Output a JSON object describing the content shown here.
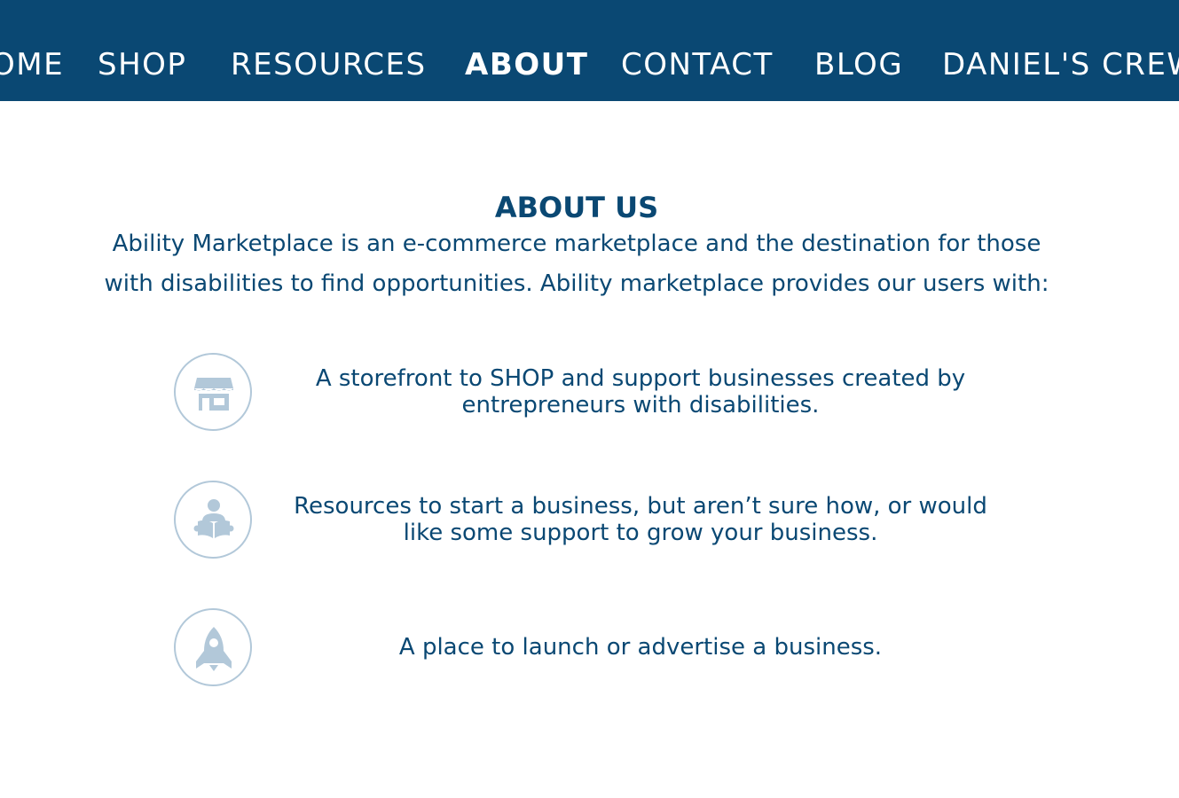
{
  "nav": {
    "items": [
      {
        "label": "OME",
        "active": false
      },
      {
        "label": "SHOP",
        "active": false
      },
      {
        "label": "RESOURCES",
        "active": false
      },
      {
        "label": "ABOUT",
        "active": true
      },
      {
        "label": "CONTACT",
        "active": false
      },
      {
        "label": "BLOG",
        "active": false
      },
      {
        "label": "DANIEL'S CREW",
        "active": false
      }
    ]
  },
  "about": {
    "title": "ABOUT US",
    "intro_line1": "Ability Marketplace is an e-commerce marketplace and the destination for those",
    "intro_line2": "with disabilities to find opportunities. Ability marketplace provides our users with:"
  },
  "features": [
    {
      "icon": "storefront-icon",
      "text": "A storefront to SHOP and support businesses created by entrepreneurs with disabilities."
    },
    {
      "icon": "reading-person-icon",
      "text": "Resources to start a business, but aren’t sure how, or would like some support to grow your business."
    },
    {
      "icon": "rocket-icon",
      "text": "A place to launch or advertise a business."
    }
  ],
  "colors": {
    "nav_background": "#0a4873",
    "text_primary": "#0a4873",
    "icon_accent": "#b2c8d9"
  }
}
